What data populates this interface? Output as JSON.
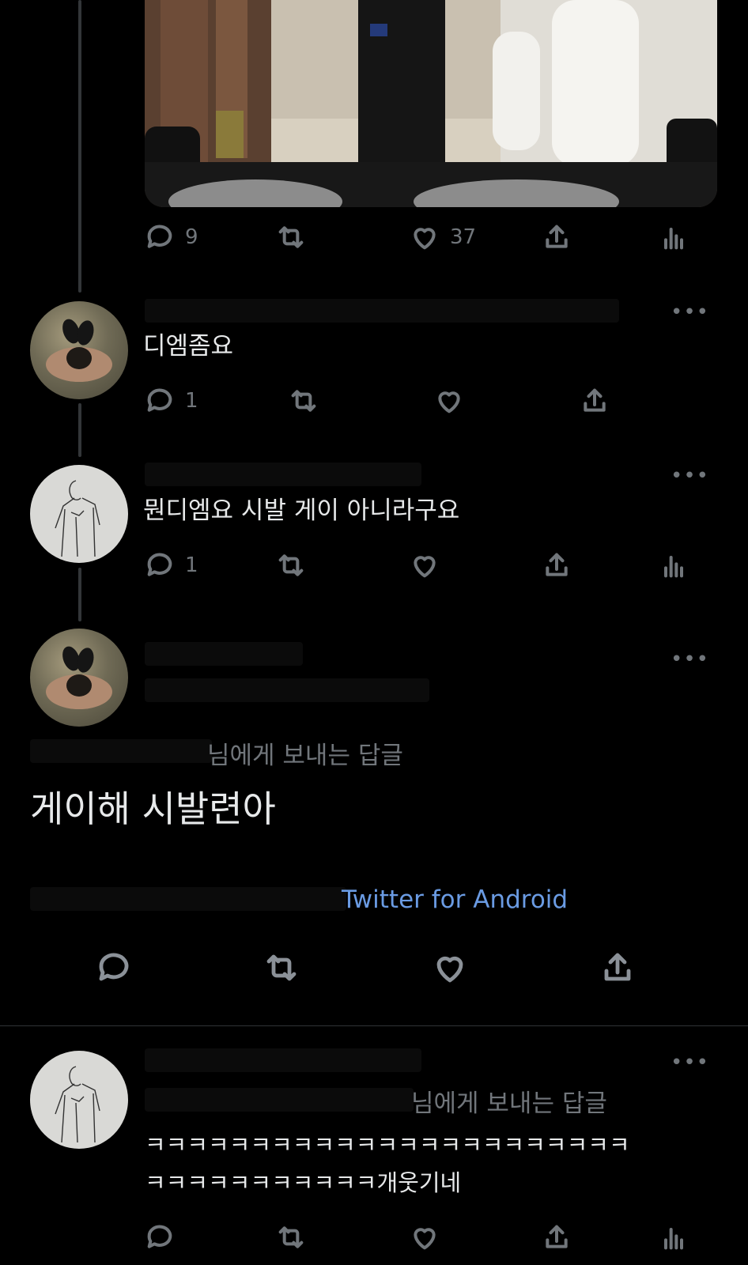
{
  "main_tweet": {
    "replies": "9",
    "likes": "37"
  },
  "reply1": {
    "text": "디엠좀요",
    "replies": "1",
    "more_icon": "more-icon"
  },
  "reply2": {
    "text": "뭔디엠요 시발 게이 아니라구요",
    "replies": "1"
  },
  "focused_tweet": {
    "replying_to": "님에게 보내는 답글",
    "text": "게이해 시발련아",
    "source": "Twitter for Android"
  },
  "reply3": {
    "replying_to": "님에게 보내는 답글",
    "text_line1": "ㅋㅋㅋㅋㅋㅋㅋㅋㅋㅋㅋㅋㅋㅋㅋㅋㅋㅋㅋㅋㅋㅋㅋ",
    "text_line2": "ㅋㅋㅋㅋㅋㅋㅋㅋㅋㅋㅋ개웃기네"
  },
  "icons": [
    "reply-icon",
    "retweet-icon",
    "like-icon",
    "share-icon",
    "analytics-icon",
    "more-icon"
  ],
  "colors": {
    "background": "#000000",
    "text": "#e7e9ea",
    "muted": "#71767b",
    "link": "#6a9be3"
  }
}
